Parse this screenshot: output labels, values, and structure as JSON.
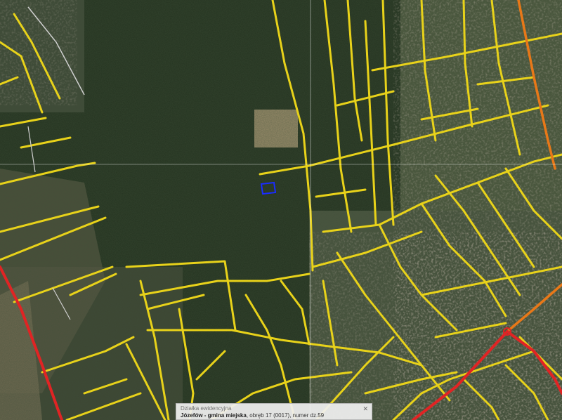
{
  "map": {
    "type": "aerial-map",
    "crosshair": true,
    "colors": {
      "local_road": "#e8d21a",
      "main_road": "#e87818",
      "national_road": "#e02424",
      "parcel_outline": "#1a2cff",
      "crosshair": "#ffffff"
    }
  },
  "popup": {
    "title": "Działka ewidencyjna",
    "location": "Józefów - gmina miejska",
    "detail": ", obręb 17 (0017), numer dz.59",
    "close_icon": "close-icon"
  }
}
